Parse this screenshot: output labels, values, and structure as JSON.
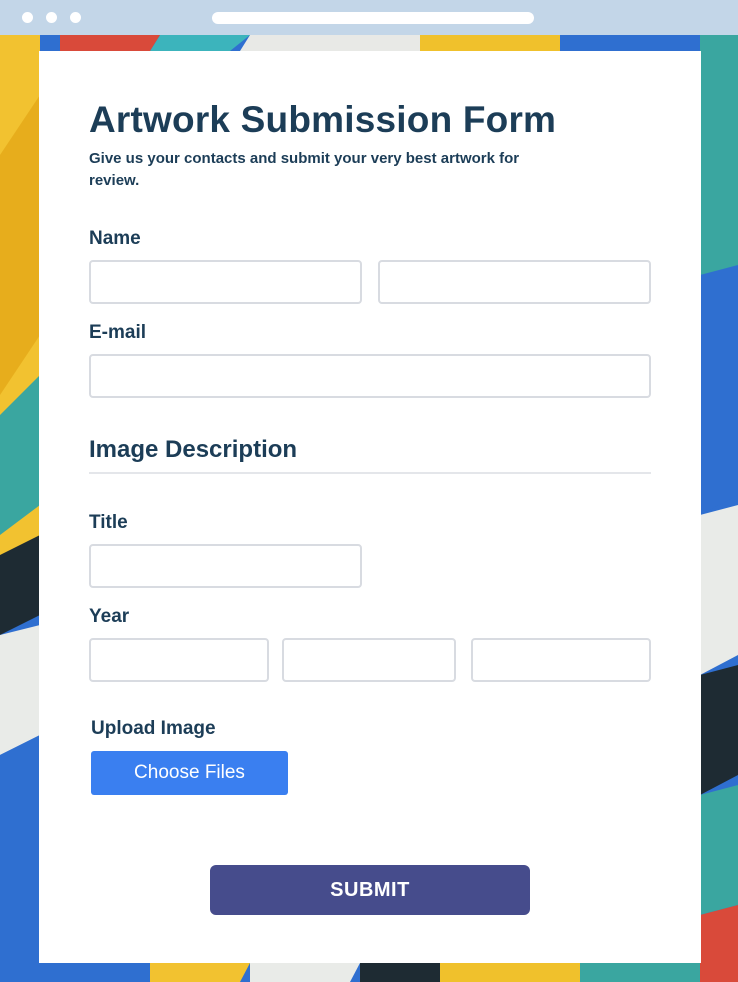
{
  "colors": {
    "heading": "#1c3d57",
    "browser_bar": "#c3d6e8",
    "choose_files_button": "#3a7ff0",
    "submit_button": "#464c8c",
    "input_border": "#d8dbe1"
  },
  "form": {
    "title": "Artwork Submission Form",
    "subtitle": "Give us your contacts and submit your very best artwork for review."
  },
  "fields": {
    "name_label": "Name",
    "email_label": "E-mail",
    "image_description_heading": "Image Description",
    "title_label": "Title",
    "year_label": "Year",
    "upload_label": "Upload Image",
    "choose_files_label": "Choose Files"
  },
  "actions": {
    "submit_label": "SUBMIT"
  }
}
